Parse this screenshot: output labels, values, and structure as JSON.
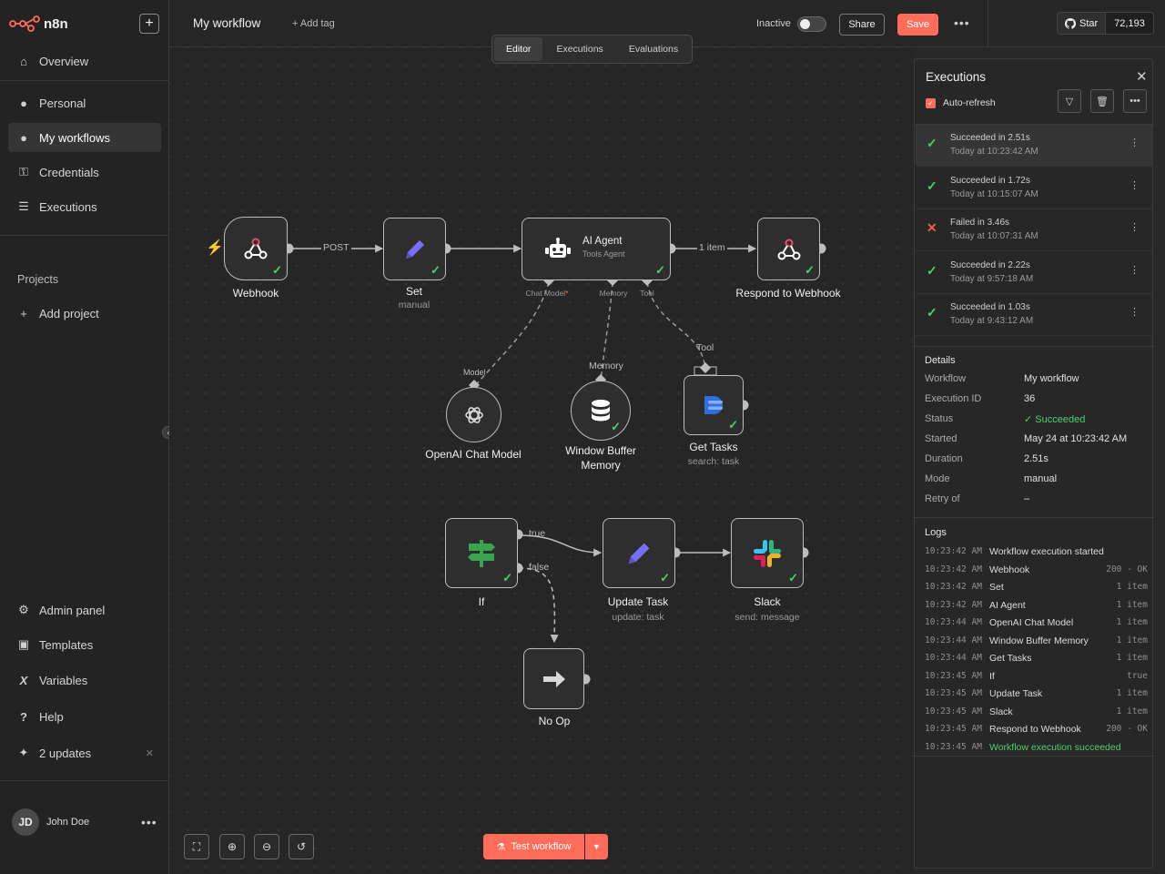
{
  "app": {
    "name": "n8n"
  },
  "sidebar": {
    "overview": "Overview",
    "personal": "Personal",
    "my_workflows": "My workflows",
    "credentials": "Credentials",
    "executions": "Executions",
    "projects_label": "Projects",
    "add_project": "Add project",
    "admin_panel": "Admin panel",
    "templates": "Templates",
    "variables": "Variables",
    "help": "Help",
    "updates": "2 updates",
    "user_initials": "JD",
    "user_name": "John Doe"
  },
  "header": {
    "workflow_name": "My workflow",
    "add_tag": "+ Add tag",
    "status": "Inactive",
    "share": "Share",
    "save": "Save",
    "github_star": "Star",
    "github_count": "72,193"
  },
  "tabs": [
    "Editor",
    "Executions",
    "Evaluations"
  ],
  "canvas": {
    "nodes": {
      "webhook": "Webhook",
      "set": "Set",
      "set_sub": "manual",
      "agent": "AI Agent",
      "agent_sub": "Tools Agent",
      "respond": "Respond to Webhook",
      "openai": "OpenAI Chat Model",
      "memory_l1": "Window Buffer",
      "memory_l2": "Memory",
      "gettasks": "Get Tasks",
      "gettasks_sub": "search: task",
      "if": "If",
      "update": "Update Task",
      "update_sub": "update: task",
      "slack": "Slack",
      "slack_sub": "send: message",
      "noop": "No Op"
    },
    "edge_labels": {
      "post": "POST",
      "one_item": "1 item",
      "true": "true",
      "false": "false",
      "tool": "Tool",
      "memory": "Memory",
      "model": "Model"
    },
    "ports": {
      "chat_model": "Chat Model",
      "required": "*",
      "memory": "Memory",
      "tool": "Tool"
    },
    "test_button": "Test workflow"
  },
  "executions_panel": {
    "title": "Executions",
    "auto_refresh": "Auto-refresh",
    "items": [
      {
        "status": "success",
        "label": "Succeeded in 2.51s",
        "time": "Today at 10:23:42 AM"
      },
      {
        "status": "success",
        "label": "Succeeded in 1.72s",
        "time": "Today at 10:15:07 AM"
      },
      {
        "status": "error",
        "label": "Failed in 3.46s",
        "time": "Today at 10:07:31 AM"
      },
      {
        "status": "success",
        "label": "Succeeded in 2.22s",
        "time": "Today at 9:57:18 AM"
      },
      {
        "status": "success",
        "label": "Succeeded in 1.03s",
        "time": "Today at 9:43:12 AM"
      }
    ],
    "details_title": "Details",
    "details": [
      {
        "key": "Workflow",
        "value": "My workflow"
      },
      {
        "key": "Execution ID",
        "value": "36"
      },
      {
        "key": "Status",
        "value": "Succeeded"
      },
      {
        "key": "Started",
        "value": "May 24 at 10:23:42 AM"
      },
      {
        "key": "Duration",
        "value": "2.51s"
      },
      {
        "key": "Mode",
        "value": "manual"
      },
      {
        "key": "Retry of",
        "value": "–"
      }
    ],
    "logs_title": "Logs",
    "logs": [
      {
        "time": "10:23:42 AM",
        "msg": "Workflow execution started",
        "res": ""
      },
      {
        "time": "10:23:42 AM",
        "msg": "Webhook",
        "res": "200 - OK"
      },
      {
        "time": "10:23:42 AM",
        "msg": "Set",
        "res": "1 item"
      },
      {
        "time": "10:23:42 AM",
        "msg": "AI Agent",
        "res": "1 item"
      },
      {
        "time": "10:23:44 AM",
        "msg": "OpenAI Chat Model",
        "res": "1 item"
      },
      {
        "time": "10:23:44 AM",
        "msg": "Window Buffer Memory",
        "res": "1 item"
      },
      {
        "time": "10:23:44 AM",
        "msg": "Get Tasks",
        "res": "1 item"
      },
      {
        "time": "10:23:45 AM",
        "msg": "If",
        "res": "true"
      },
      {
        "time": "10:23:45 AM",
        "msg": "Update Task",
        "res": "1 item"
      },
      {
        "time": "10:23:45 AM",
        "msg": "Slack",
        "res": "1 item"
      },
      {
        "time": "10:23:45 AM",
        "msg": "Respond to Webhook",
        "res": "200 - OK"
      },
      {
        "time": "10:23:45 AM",
        "msg": "Workflow execution succeeded",
        "res": ""
      }
    ]
  },
  "colors": {
    "accent": "#ff6d5a",
    "success": "#4fcf6e",
    "error": "#f05a4a"
  }
}
